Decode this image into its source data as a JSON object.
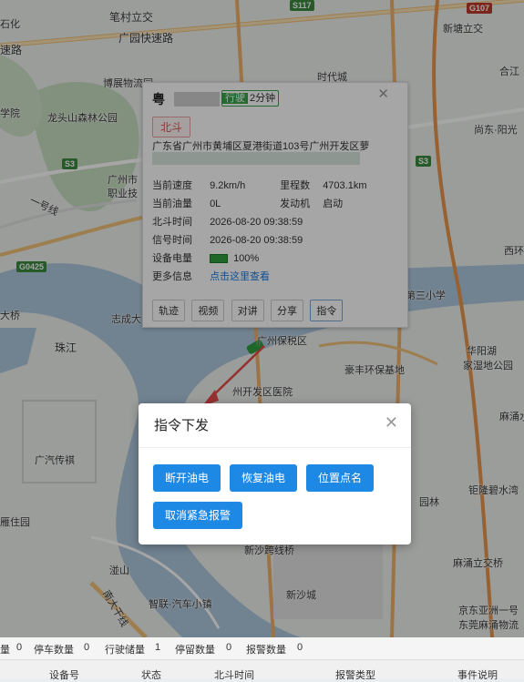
{
  "map_labels": [
    {
      "id": "shiqiao",
      "text": "石化"
    },
    {
      "id": "bicun",
      "text": "笔村立交"
    },
    {
      "id": "guangyuan",
      "text": "广园快速路"
    },
    {
      "id": "sudu",
      "text": "速路"
    },
    {
      "id": "boyan",
      "text": "博展物流园"
    },
    {
      "id": "shidai",
      "text": "时代城"
    },
    {
      "id": "xintang",
      "text": "新塘立交"
    },
    {
      "id": "hexi",
      "text": "合江"
    },
    {
      "id": "xueyuan",
      "text": "学院"
    },
    {
      "id": "longtou",
      "text": "龙头山森林公园"
    },
    {
      "id": "shangdong",
      "text": "尚东·阳光"
    },
    {
      "id": "guangzhoushi",
      "text": "广州市"
    },
    {
      "id": "zhiye",
      "text": "职业技"
    },
    {
      "id": "yigao",
      "text": "一号线"
    },
    {
      "id": "daqiao",
      "text": "大桥"
    },
    {
      "id": "zhicheng",
      "text": "志成大"
    },
    {
      "id": "zhujiang",
      "text": "珠江"
    },
    {
      "id": "xihu",
      "text": "西环"
    },
    {
      "id": "disanxiao",
      "text": "第三小学"
    },
    {
      "id": "baoshuiqu",
      "text": "广州保税区"
    },
    {
      "id": "kaifaqu",
      "text": "州开发区医院"
    },
    {
      "id": "haofeng",
      "text": "豪丰环保基地"
    },
    {
      "id": "huayang",
      "text": "华阳湖"
    },
    {
      "id": "jiaju",
      "text": "家湿地公园"
    },
    {
      "id": "machong",
      "text": "麻涌水"
    },
    {
      "id": "guangqi",
      "text": "广汽传祺"
    },
    {
      "id": "zhangxiang",
      "text": "钜隆碧水湾"
    },
    {
      "id": "yanzhu",
      "text": "雁住园"
    },
    {
      "id": "mashan",
      "text": "湴山"
    },
    {
      "id": "xinsha",
      "text": "新沙跨线桥"
    },
    {
      "id": "xinshacheng",
      "text": "新沙城"
    },
    {
      "id": "zhihui",
      "text": "智联·汽车小镇"
    },
    {
      "id": "machongli",
      "text": "麻涌立交桥"
    },
    {
      "id": "jingdong",
      "text": "京东亚洲一号"
    },
    {
      "id": "dongguan",
      "text": "东莞麻涌物流"
    },
    {
      "id": "nanta",
      "text": "南大干线"
    },
    {
      "id": "yuanlin",
      "text": "园林"
    }
  ],
  "shields": [
    {
      "id": "s117",
      "text": "S117"
    },
    {
      "id": "g107",
      "text": "G107"
    },
    {
      "id": "s3a",
      "text": "S3"
    },
    {
      "id": "g0425",
      "text": "G0425"
    },
    {
      "id": "s3b",
      "text": "S3"
    }
  ],
  "popup": {
    "plate": "粤",
    "status_tag": "行驶",
    "status_duration": "2分钟",
    "locator_tag": "北斗",
    "address": "广东省广州市黄埔区夏港街道103号广州开发区萝",
    "rows": {
      "speed_label": "当前速度",
      "speed_value": "9.2km/h",
      "mileage_label": "里程数",
      "mileage_value": "4703.1km",
      "fuel_label": "当前油量",
      "fuel_value": "0L",
      "engine_label": "发动机",
      "engine_value": "启动",
      "bd_time_label": "北斗时间",
      "bd_time_value": "2026-08-20 09:38:59",
      "signal_time_label": "信号时间",
      "signal_time_value": "2026-08-20 09:38:59",
      "battery_label": "设备电量",
      "battery_value": "100%",
      "more_label": "更多信息",
      "more_link": "点击这里查看"
    },
    "buttons": {
      "track": "轨迹",
      "video": "视频",
      "talk": "对讲",
      "share": "分享",
      "command": "指令"
    }
  },
  "dialog": {
    "title": "指令下发",
    "buttons": {
      "cut_power": "断开油电",
      "restore_power": "恢复油电",
      "locate": "位置点名",
      "cancel_alarm": "取消紧急报警"
    }
  },
  "statbar": {
    "total_label": "量",
    "total_value": "0",
    "parked_label": "停车数量",
    "parked_value": "0",
    "driving_label": "行驶储量",
    "driving_value": "1",
    "stopped_label": "停留数量",
    "stopped_value": "0",
    "alarm_label": "报警数量",
    "alarm_value": "0"
  },
  "table_headers": [
    "设备号",
    "状态",
    "北斗时间",
    "报警类型",
    "事件说明"
  ],
  "colors": {
    "primary": "#1e88e5",
    "running": "#3aa34a",
    "beidou": "#d9534f",
    "link": "#1e7be0"
  }
}
